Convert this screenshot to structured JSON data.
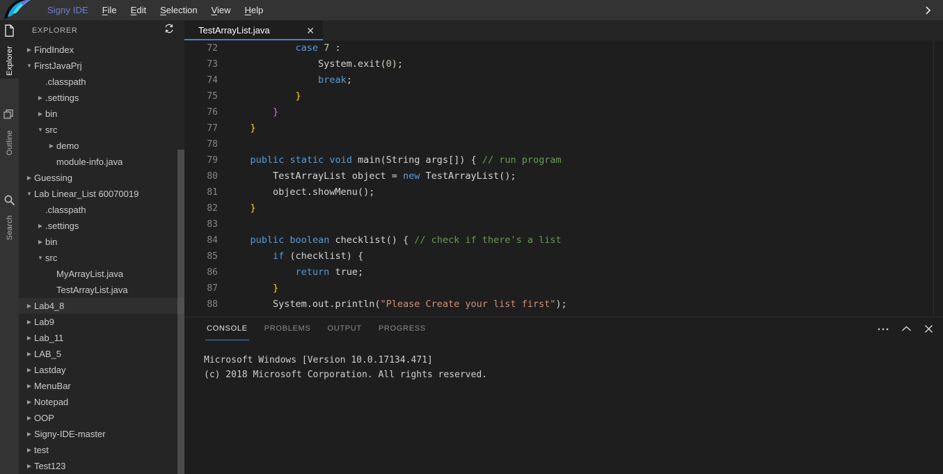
{
  "app": {
    "brand": "Signy IDE",
    "logo_icon": "signy-feather-logo",
    "menus": [
      {
        "label": "File",
        "mnemonic": "F"
      },
      {
        "label": "Edit",
        "mnemonic": "E"
      },
      {
        "label": "Selection",
        "mnemonic": "S"
      },
      {
        "label": "View",
        "mnemonic": "V"
      },
      {
        "label": "Help",
        "mnemonic": "H"
      }
    ],
    "expand_icon": "chevron-right-icon"
  },
  "activity_bar": {
    "items": [
      {
        "label": "Explorer",
        "icon": "file-icon",
        "active": true
      },
      {
        "label": "Outline",
        "icon": "layers-icon",
        "active": false
      },
      {
        "label": "Search",
        "icon": "search-icon",
        "active": false
      }
    ]
  },
  "sidebar": {
    "title": "EXPLORER",
    "refresh_icon": "refresh-icon",
    "tree": [
      {
        "label": "FindIndex",
        "depth": 1,
        "twisty": "collapsed",
        "selected": false
      },
      {
        "label": "FirstJavaPrj",
        "depth": 1,
        "twisty": "expanded",
        "selected": false
      },
      {
        "label": ".classpath",
        "depth": 2,
        "twisty": "none",
        "selected": false
      },
      {
        "label": ".settings",
        "depth": 2,
        "twisty": "collapsed",
        "selected": false
      },
      {
        "label": "bin",
        "depth": 2,
        "twisty": "collapsed",
        "selected": false
      },
      {
        "label": "src",
        "depth": 2,
        "twisty": "expanded",
        "selected": false
      },
      {
        "label": "demo",
        "depth": 3,
        "twisty": "collapsed",
        "selected": false
      },
      {
        "label": "module-info.java",
        "depth": 3,
        "twisty": "none",
        "selected": false
      },
      {
        "label": "Guessing",
        "depth": 1,
        "twisty": "collapsed",
        "selected": false
      },
      {
        "label": "Lab Linear_List 60070019",
        "depth": 1,
        "twisty": "expanded",
        "selected": false
      },
      {
        "label": ".classpath",
        "depth": 2,
        "twisty": "none",
        "selected": false
      },
      {
        "label": ".settings",
        "depth": 2,
        "twisty": "collapsed",
        "selected": false
      },
      {
        "label": "bin",
        "depth": 2,
        "twisty": "collapsed",
        "selected": false
      },
      {
        "label": "src",
        "depth": 2,
        "twisty": "expanded",
        "selected": false
      },
      {
        "label": "MyArrayList.java",
        "depth": 3,
        "twisty": "none",
        "selected": false
      },
      {
        "label": "TestArrayList.java",
        "depth": 3,
        "twisty": "none",
        "selected": false
      },
      {
        "label": "Lab4_8",
        "depth": 1,
        "twisty": "collapsed",
        "selected": true
      },
      {
        "label": "Lab9",
        "depth": 1,
        "twisty": "collapsed",
        "selected": false
      },
      {
        "label": "Lab_11",
        "depth": 1,
        "twisty": "collapsed",
        "selected": false
      },
      {
        "label": "LAB_5",
        "depth": 1,
        "twisty": "collapsed",
        "selected": false
      },
      {
        "label": "Lastday",
        "depth": 1,
        "twisty": "collapsed",
        "selected": false
      },
      {
        "label": "MenuBar",
        "depth": 1,
        "twisty": "collapsed",
        "selected": false
      },
      {
        "label": "Notepad",
        "depth": 1,
        "twisty": "collapsed",
        "selected": false
      },
      {
        "label": "OOP",
        "depth": 1,
        "twisty": "collapsed",
        "selected": false
      },
      {
        "label": "Signy-IDE-master",
        "depth": 1,
        "twisty": "collapsed",
        "selected": false
      },
      {
        "label": "test",
        "depth": 1,
        "twisty": "collapsed",
        "selected": false
      },
      {
        "label": "Test123",
        "depth": 1,
        "twisty": "collapsed",
        "selected": false
      }
    ]
  },
  "editor": {
    "tabs": [
      {
        "label": "TestArrayList.java",
        "active": true,
        "close_icon": "close-icon"
      }
    ],
    "first_line_number": 72,
    "lines": [
      {
        "num": 72,
        "tokens": [
          {
            "t": "            ",
            "c": "p"
          },
          {
            "t": "case",
            "c": "k"
          },
          {
            "t": " ",
            "c": "p"
          },
          {
            "t": "7",
            "c": "n"
          },
          {
            "t": " :",
            "c": "p"
          }
        ]
      },
      {
        "num": 73,
        "tokens": [
          {
            "t": "                System.exit(",
            "c": "p"
          },
          {
            "t": "0",
            "c": "n"
          },
          {
            "t": ");",
            "c": "p"
          }
        ]
      },
      {
        "num": 74,
        "tokens": [
          {
            "t": "                ",
            "c": "p"
          },
          {
            "t": "break",
            "c": "k"
          },
          {
            "t": ";",
            "c": "p"
          }
        ]
      },
      {
        "num": 75,
        "tokens": [
          {
            "t": "            ",
            "c": "p"
          },
          {
            "t": "}",
            "c": "b1"
          }
        ]
      },
      {
        "num": 76,
        "tokens": [
          {
            "t": "        ",
            "c": "p"
          },
          {
            "t": "}",
            "c": "b2"
          }
        ]
      },
      {
        "num": 77,
        "tokens": [
          {
            "t": "    ",
            "c": "p"
          },
          {
            "t": "}",
            "c": "b1"
          }
        ]
      },
      {
        "num": 78,
        "tokens": []
      },
      {
        "num": 79,
        "tokens": [
          {
            "t": "    ",
            "c": "p"
          },
          {
            "t": "public",
            "c": "k"
          },
          {
            "t": " ",
            "c": "p"
          },
          {
            "t": "static",
            "c": "k"
          },
          {
            "t": " ",
            "c": "p"
          },
          {
            "t": "void",
            "c": "k"
          },
          {
            "t": " main(String args[]) { ",
            "c": "p"
          },
          {
            "t": "// run program",
            "c": "c"
          }
        ]
      },
      {
        "num": 80,
        "tokens": [
          {
            "t": "        TestArrayList object = ",
            "c": "p"
          },
          {
            "t": "new",
            "c": "k"
          },
          {
            "t": " TestArrayList();",
            "c": "p"
          }
        ]
      },
      {
        "num": 81,
        "tokens": [
          {
            "t": "        object.showMenu();",
            "c": "p"
          }
        ]
      },
      {
        "num": 82,
        "tokens": [
          {
            "t": "    ",
            "c": "p"
          },
          {
            "t": "}",
            "c": "b1"
          }
        ]
      },
      {
        "num": 83,
        "tokens": []
      },
      {
        "num": 84,
        "tokens": [
          {
            "t": "    ",
            "c": "p"
          },
          {
            "t": "public",
            "c": "k"
          },
          {
            "t": " ",
            "c": "p"
          },
          {
            "t": "boolean",
            "c": "k"
          },
          {
            "t": " checklist() { ",
            "c": "p"
          },
          {
            "t": "// check if there's a list",
            "c": "c"
          }
        ]
      },
      {
        "num": 85,
        "tokens": [
          {
            "t": "        ",
            "c": "p"
          },
          {
            "t": "if",
            "c": "k"
          },
          {
            "t": " (checklist) {",
            "c": "p"
          }
        ]
      },
      {
        "num": 86,
        "tokens": [
          {
            "t": "            ",
            "c": "p"
          },
          {
            "t": "return",
            "c": "k"
          },
          {
            "t": " true;",
            "c": "p"
          }
        ]
      },
      {
        "num": 87,
        "tokens": [
          {
            "t": "        ",
            "c": "p"
          },
          {
            "t": "}",
            "c": "b1"
          }
        ]
      },
      {
        "num": 88,
        "tokens": [
          {
            "t": "        System.out.println(",
            "c": "p"
          },
          {
            "t": "\"Please Create your list first\"",
            "c": "s"
          },
          {
            "t": ");",
            "c": "p"
          }
        ]
      }
    ]
  },
  "panel": {
    "tabs": [
      {
        "label": "CONSOLE",
        "active": true
      },
      {
        "label": "PROBLEMS",
        "active": false
      },
      {
        "label": "OUTPUT",
        "active": false
      },
      {
        "label": "PROGRESS",
        "active": false
      }
    ],
    "actions": [
      {
        "name": "more-actions",
        "icon": "ellipsis-icon"
      },
      {
        "name": "maximize-panel",
        "icon": "chevron-up-icon"
      },
      {
        "name": "close-panel",
        "icon": "close-icon"
      }
    ],
    "console_lines": [
      "Microsoft Windows [Version 10.0.17134.471]",
      "(c) 2018 Microsoft Corporation. All rights reserved."
    ]
  },
  "colors": {
    "accent": "#4b7fd4",
    "brand_text": "#6f7fd1",
    "titlebar_bg": "#333333",
    "sidebar_bg": "#252526",
    "editor_bg": "#1e1e1e",
    "selected_row_bg": "#2f2f2f"
  }
}
